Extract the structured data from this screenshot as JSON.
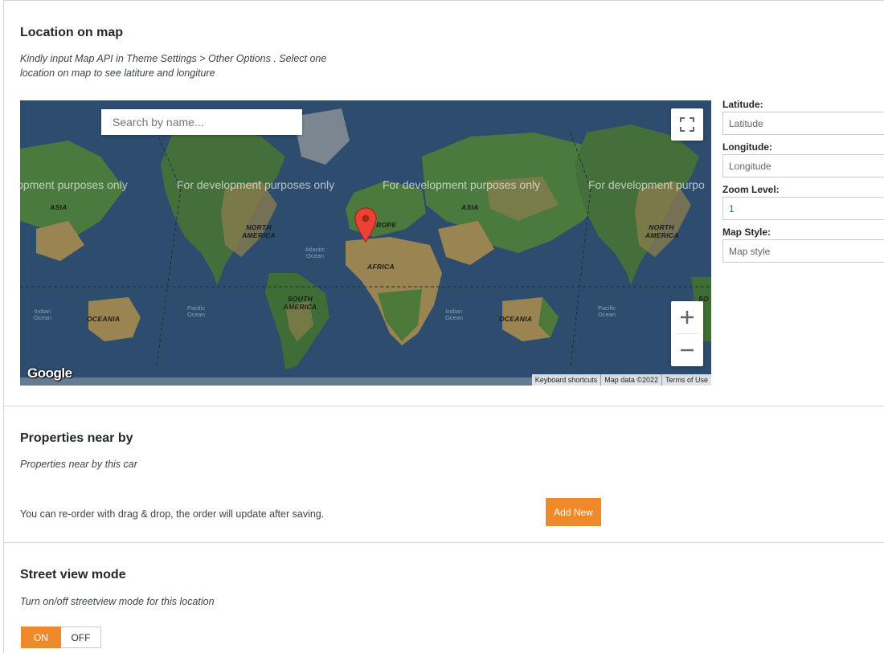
{
  "location": {
    "title": "Location on map",
    "description_line1": "Kindly input Map API in Theme Settings > Other Options . Select one",
    "description_line2": "location on map to see latiture and longiture",
    "map": {
      "search_placeholder": "Search by name...",
      "watermark": "For development purposes only",
      "watermark_partial_left": "opment purposes only",
      "watermark_partial_right": "For development purpo",
      "labels": {
        "asia": "ASIA",
        "north_america": "NORTH AMERICA",
        "europe": "ROPE",
        "africa": "AFRICA",
        "south_america": "SOUTH AMERICA",
        "oceania": "OCEANIA",
        "atlantic": "Atlantic Ocean",
        "indian": "Indian Ocean",
        "pacific": "Pacific Ocean",
        "so_partial": "SO"
      },
      "logo": "Google",
      "attribution": [
        "Keyboard shortcuts",
        "Map data ©2022",
        "Terms of Use"
      ],
      "zoom_in": "+",
      "zoom_out": "−"
    },
    "fields": {
      "latitude_label": "Latitude:",
      "latitude_placeholder": "Latitude",
      "longitude_label": "Longitude:",
      "longitude_placeholder": "Longitude",
      "zoom_label": "Zoom Level:",
      "zoom_value": "1",
      "style_label": "Map Style:",
      "style_placeholder": "Map style"
    }
  },
  "nearby": {
    "title": "Properties near by",
    "description": "Properties near by this car",
    "hint": "You can re-order with drag & drop, the order will update after saving.",
    "add_button": "Add New"
  },
  "street": {
    "title": "Street view mode",
    "description": "Turn on/off streetview mode for this location",
    "on_label": "ON",
    "off_label": "OFF"
  },
  "colors": {
    "accent": "#f0892a",
    "ocean": "#2c4a6b",
    "land": "#4a7a3e",
    "desert": "#9a8552"
  }
}
